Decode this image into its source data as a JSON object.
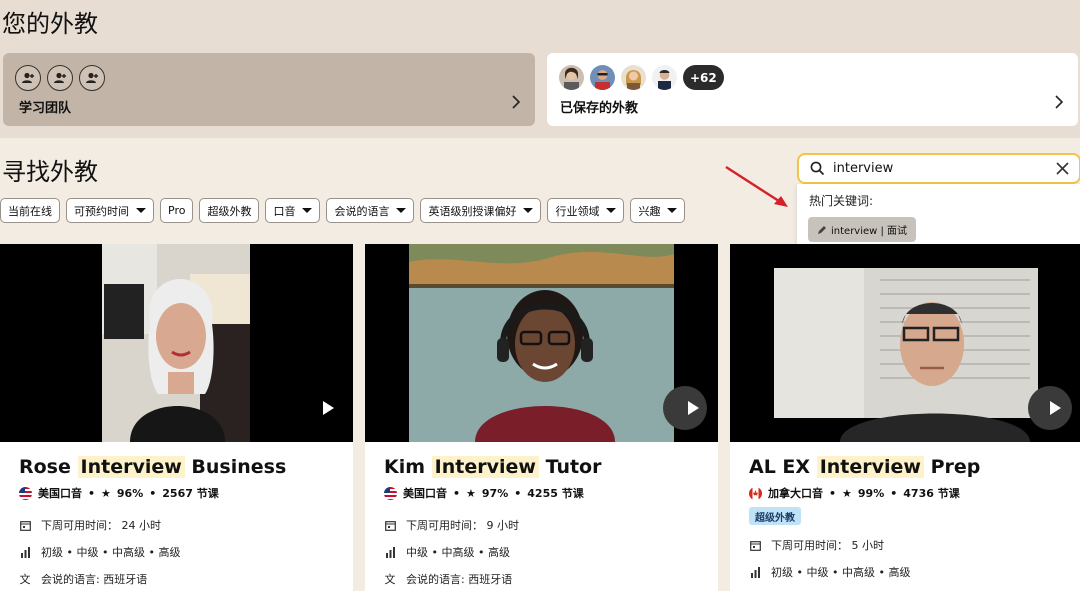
{
  "header": {
    "title": "您的外教"
  },
  "team_card": {
    "label": "学习团队",
    "icons": [
      "add-person-icon",
      "add-person-icon",
      "add-person-icon"
    ]
  },
  "saved_card": {
    "label": "已保存的外教",
    "more_count": "+62"
  },
  "find": {
    "title": "寻找外教"
  },
  "filters": [
    {
      "label": "当前在线",
      "dropdown": false
    },
    {
      "label": "可预约时间",
      "dropdown": true
    },
    {
      "label": "Pro",
      "dropdown": false
    },
    {
      "label": "超级外教",
      "dropdown": false
    },
    {
      "label": "口音",
      "dropdown": true
    },
    {
      "label": "会说的语言",
      "dropdown": true
    },
    {
      "label": "英语级别授课偏好",
      "dropdown": true
    },
    {
      "label": "行业领域",
      "dropdown": true
    },
    {
      "label": "兴趣",
      "dropdown": true
    }
  ],
  "search": {
    "value": "interview",
    "hot_label": "热门关键词:",
    "keyword": "interview | 面试"
  },
  "tutors": [
    {
      "first": "Rose",
      "highlight": "Interview",
      "last": "Business",
      "accent": "美国口音",
      "rating": "96%",
      "lessons": "2567 节课",
      "availability": "下周可用时间： 24 小时",
      "levels": "初级 • 中级 • 中高级 • 高级",
      "languages": "会说的语言: 西班牙语",
      "super": ""
    },
    {
      "first": "Kim",
      "highlight": "Interview",
      "last": "Tutor",
      "accent": "美国口音",
      "rating": "97%",
      "lessons": "4255 节课",
      "availability": "下周可用时间： 9 小时",
      "levels": "中级 • 中高级 • 高级",
      "languages": "会说的语言: 西班牙语",
      "super": ""
    },
    {
      "first": "AL EX",
      "highlight": "Interview",
      "last": "Prep",
      "accent": "加拿大口音",
      "rating": "99%",
      "lessons": "4736 节课",
      "availability": "下周可用时间： 5 小时",
      "levels": "初级 • 中级 • 中高级 • 高级",
      "languages": "",
      "super": "超级外教"
    }
  ],
  "colors": {
    "search_border": "#f2c44a",
    "highlight": "#fdf2c9",
    "super_badge": "#bfe2f7",
    "arrow": "#d6202a"
  }
}
